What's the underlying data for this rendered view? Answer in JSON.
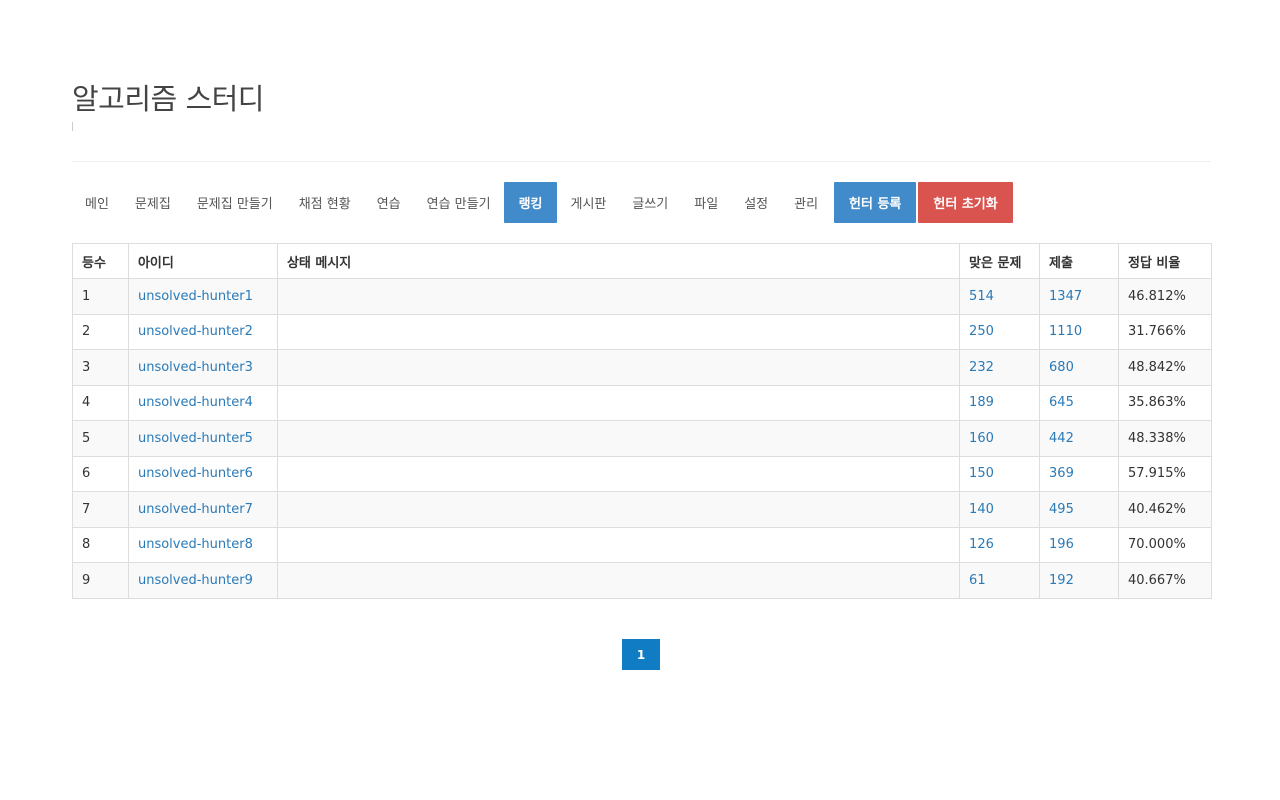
{
  "page": {
    "title": "알고리즘 스터디"
  },
  "nav": {
    "items": [
      {
        "label": "메인",
        "name": "nav-main"
      },
      {
        "label": "문제집",
        "name": "nav-problemsets"
      },
      {
        "label": "문제집 만들기",
        "name": "nav-create-problemset"
      },
      {
        "label": "채점 현황",
        "name": "nav-judge-status"
      },
      {
        "label": "연습",
        "name": "nav-practice"
      },
      {
        "label": "연습 만들기",
        "name": "nav-create-practice"
      },
      {
        "label": "랭킹",
        "name": "nav-ranking",
        "active": true
      },
      {
        "label": "게시판",
        "name": "nav-board"
      },
      {
        "label": "글쓰기",
        "name": "nav-write"
      },
      {
        "label": "파일",
        "name": "nav-files"
      },
      {
        "label": "설정",
        "name": "nav-settings"
      },
      {
        "label": "관리",
        "name": "nav-admin"
      }
    ],
    "register_hunter": "헌터 등록",
    "reset_hunter": "헌터 초기화"
  },
  "table": {
    "headers": {
      "rank": "등수",
      "id": "아이디",
      "status": "상태 메시지",
      "solved": "맞은 문제",
      "submissions": "제출",
      "ratio": "정답 비율"
    },
    "rows": [
      {
        "rank": "1",
        "id": "unsolved-hunter1",
        "status": "",
        "solved": "514",
        "submissions": "1347",
        "ratio": "46.812%"
      },
      {
        "rank": "2",
        "id": "unsolved-hunter2",
        "status": "",
        "solved": "250",
        "submissions": "1110",
        "ratio": "31.766%"
      },
      {
        "rank": "3",
        "id": "unsolved-hunter3",
        "status": "",
        "solved": "232",
        "submissions": "680",
        "ratio": "48.842%"
      },
      {
        "rank": "4",
        "id": "unsolved-hunter4",
        "status": "",
        "solved": "189",
        "submissions": "645",
        "ratio": "35.863%"
      },
      {
        "rank": "5",
        "id": "unsolved-hunter5",
        "status": "",
        "solved": "160",
        "submissions": "442",
        "ratio": "48.338%"
      },
      {
        "rank": "6",
        "id": "unsolved-hunter6",
        "status": "",
        "solved": "150",
        "submissions": "369",
        "ratio": "57.915%"
      },
      {
        "rank": "7",
        "id": "unsolved-hunter7",
        "status": "",
        "solved": "140",
        "submissions": "495",
        "ratio": "40.462%"
      },
      {
        "rank": "8",
        "id": "unsolved-hunter8",
        "status": "",
        "solved": "126",
        "submissions": "196",
        "ratio": "70.000%"
      },
      {
        "rank": "9",
        "id": "unsolved-hunter9",
        "status": "",
        "solved": "61",
        "submissions": "192",
        "ratio": "40.667%"
      }
    ]
  },
  "pagination": {
    "current": "1"
  },
  "colors": {
    "primary": "#428bca",
    "danger": "#d9534f",
    "link": "#2a7ab8",
    "page_active": "#0f7cc3"
  }
}
